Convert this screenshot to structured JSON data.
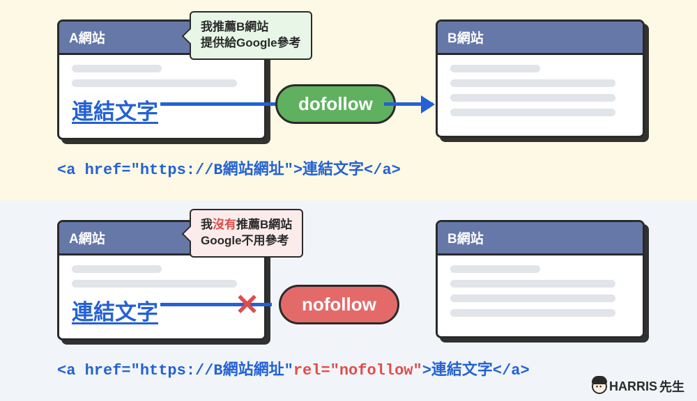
{
  "top": {
    "siteA": "A網站",
    "siteB": "B網站",
    "linkText": "連結文字",
    "bubble_l1": "我推薦B網站",
    "bubble_l2": "提供給Google參考",
    "pill": "dofollow",
    "code": "<a href=\"https://B網站網址\">連結文字</a>"
  },
  "bot": {
    "siteA": "A網站",
    "siteB": "B網站",
    "linkText": "連結文字",
    "bubble_pre": "我",
    "bubble_red": "沒有",
    "bubble_post": "推薦B網站",
    "bubble_l2": "Google不用參考",
    "pill": "nofollow",
    "code_pre": "<a href=\"https://B網站網址\"",
    "code_red": "rel=\"nofollow\"",
    "code_post": ">連結文字</a>"
  },
  "brand": {
    "name": "HARRIS",
    "suffix": "先生"
  }
}
